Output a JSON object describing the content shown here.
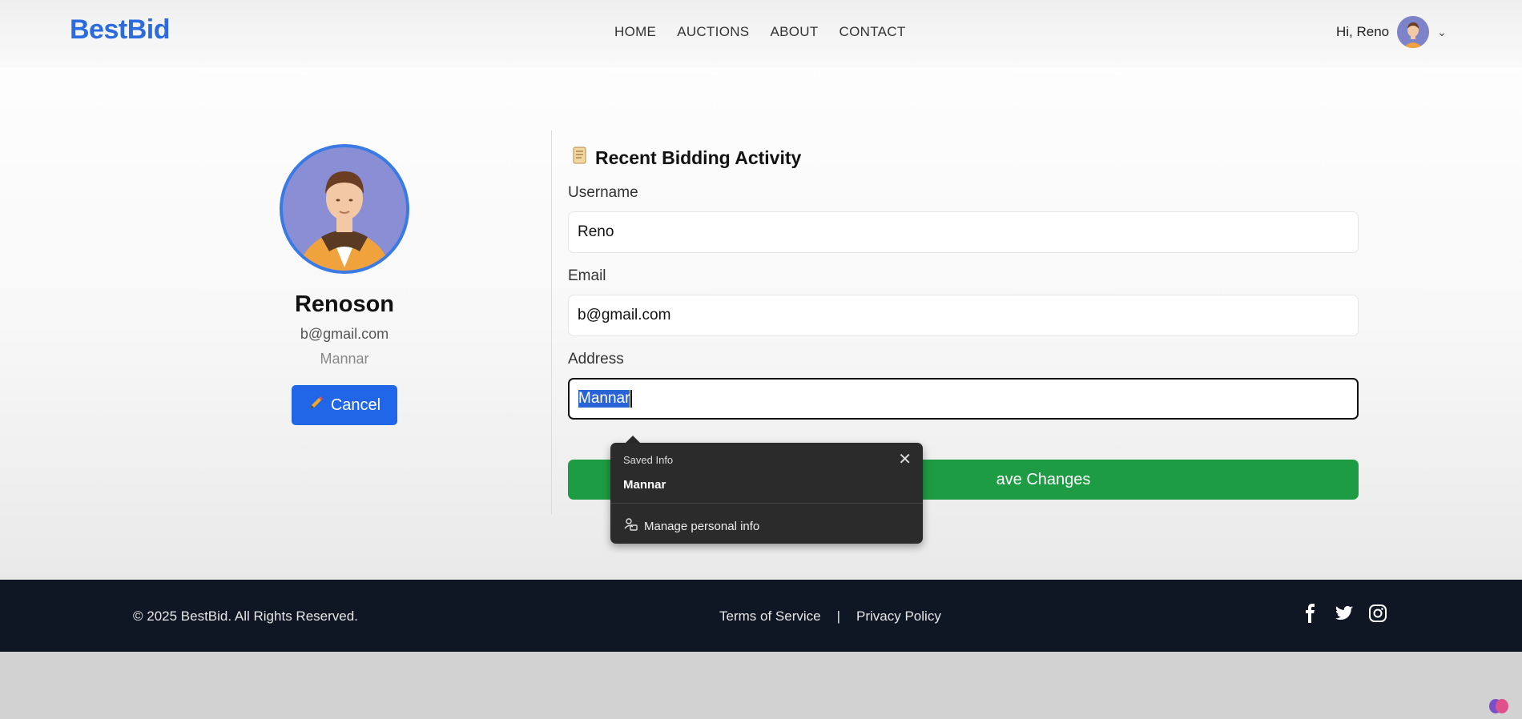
{
  "header": {
    "logo": "BestBid",
    "nav": [
      "HOME",
      "AUCTIONS",
      "ABOUT",
      "CONTACT"
    ],
    "greeting": "Hi, Reno"
  },
  "profile": {
    "name": "Renoson",
    "email": "b@gmail.com",
    "address": "Mannar",
    "cancel_label": "Cancel"
  },
  "form": {
    "section_title": "Recent Bidding Activity",
    "username_label": "Username",
    "username_value": "Reno",
    "email_label": "Email",
    "email_value": "b@gmail.com",
    "address_label": "Address",
    "address_value": "Mannar",
    "save_label": "ave Changes"
  },
  "autofill": {
    "header": "Saved Info",
    "item": "Mannar",
    "manage": "Manage personal info"
  },
  "footer": {
    "copyright": "© 2025 BestBid. All Rights Reserved.",
    "terms": "Terms of Service",
    "sep": "|",
    "privacy": "Privacy Policy",
    "socials": [
      "facebook-icon",
      "twitter-icon",
      "instagram-icon"
    ]
  },
  "colors": {
    "brand": "#2b6be0",
    "cancel": "#2166e6",
    "save": "#1d9c43",
    "footer_bg": "#0f1724"
  }
}
